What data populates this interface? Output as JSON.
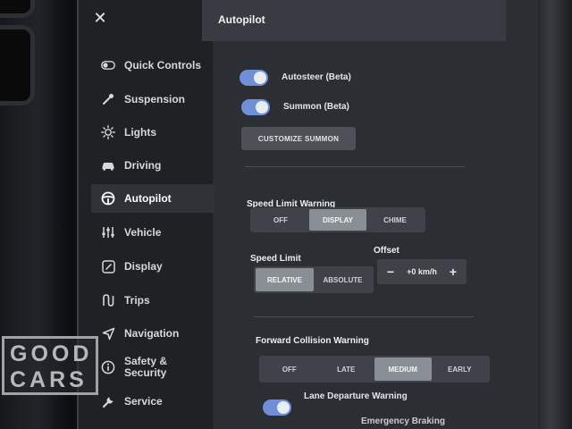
{
  "sidebar": {
    "close_symbol": "✕",
    "items": [
      {
        "label": "Quick Controls",
        "icon": "toggle-icon"
      },
      {
        "label": "Suspension",
        "icon": "wrench-icon"
      },
      {
        "label": "Lights",
        "icon": "sun-icon"
      },
      {
        "label": "Driving",
        "icon": "car-icon"
      },
      {
        "label": "Autopilot",
        "icon": "steering-wheel-icon",
        "active": true
      },
      {
        "label": "Vehicle",
        "icon": "sliders-icon"
      },
      {
        "label": "Display",
        "icon": "display-icon"
      },
      {
        "label": "Trips",
        "icon": "trips-icon"
      },
      {
        "label": "Navigation",
        "icon": "navigation-arrow-icon"
      },
      {
        "label": "Safety &",
        "label2": "Security",
        "icon": "info-icon"
      },
      {
        "label": "Service",
        "icon": "service-wrench-icon"
      }
    ]
  },
  "header": {
    "title": "Autopilot"
  },
  "autopilot": {
    "autosteer": {
      "label": "Autosteer (Beta)",
      "on": true
    },
    "summon": {
      "label": "Summon (Beta)",
      "on": true
    },
    "customize_summon": "CUSTOMIZE SUMMON",
    "speed_limit_warning": {
      "label": "Speed Limit Warning",
      "options": [
        "OFF",
        "DISPLAY",
        "CHIME"
      ],
      "selected": "DISPLAY"
    },
    "speed_limit": {
      "label": "Speed Limit",
      "options": [
        "RELATIVE",
        "ABSOLUTE"
      ],
      "selected": "RELATIVE"
    },
    "offset": {
      "label": "Offset",
      "minus": "−",
      "value": "+0 km/h",
      "plus": "+"
    },
    "forward_collision_warning": {
      "label": "Forward Collision Warning",
      "options": [
        "OFF",
        "LATE",
        "MEDIUM",
        "EARLY"
      ],
      "selected": "MEDIUM"
    },
    "lane_departure_warning": {
      "label": "Lane Departure Warning",
      "on": true
    },
    "emergency_braking": {
      "label": "Emergency Braking"
    }
  },
  "watermark": {
    "line1": "GOOD",
    "line2": "CARS"
  },
  "colors": {
    "toggle_on": "#6f8fd8",
    "sidebar_bg": "#1f2125",
    "panel_bg": "#2b2e33",
    "selected_segment": "#8a8e95"
  }
}
